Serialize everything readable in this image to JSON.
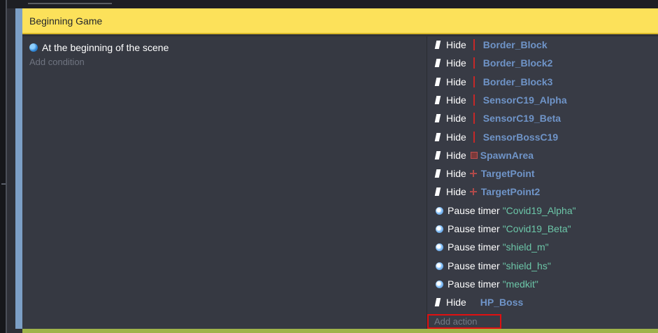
{
  "group": {
    "title": "Beginning Game"
  },
  "event": {
    "condition_label": "At the beginning of the scene",
    "condition_icon": "scene-start-icon",
    "add_condition": "Add condition",
    "add_action": "Add action"
  },
  "actions": [
    {
      "verb": "Hide",
      "icon": "hide-icon",
      "marker": "red-bar",
      "object": "Border_Block"
    },
    {
      "verb": "Hide",
      "icon": "hide-icon",
      "marker": "red-bar",
      "object": "Border_Block2"
    },
    {
      "verb": "Hide",
      "icon": "hide-icon",
      "marker": "red-bar",
      "object": "Border_Block3"
    },
    {
      "verb": "Hide",
      "icon": "hide-icon",
      "marker": "red-bar",
      "object": "SensorC19_Alpha"
    },
    {
      "verb": "Hide",
      "icon": "hide-icon",
      "marker": "red-bar",
      "object": "SensorC19_Beta"
    },
    {
      "verb": "Hide",
      "icon": "hide-icon",
      "marker": "red-bar",
      "object": "SensorBossC19"
    },
    {
      "verb": "Hide",
      "icon": "hide-icon",
      "marker": "red-box",
      "object": "SpawnArea"
    },
    {
      "verb": "Hide",
      "icon": "hide-icon",
      "marker": "red-cross",
      "object": "TargetPoint"
    },
    {
      "verb": "Hide",
      "icon": "hide-icon",
      "marker": "red-cross",
      "object": "TargetPoint2"
    },
    {
      "verb": "Pause timer",
      "icon": "timer-icon",
      "timer": "\"Covid19_Alpha\""
    },
    {
      "verb": "Pause timer",
      "icon": "timer-icon",
      "timer": "\"Covid19_Beta\""
    },
    {
      "verb": "Pause timer",
      "icon": "timer-icon",
      "timer": "\"shield_m\""
    },
    {
      "verb": "Pause timer",
      "icon": "timer-icon",
      "timer": "\"shield_hs\""
    },
    {
      "verb": "Pause timer",
      "icon": "timer-icon",
      "timer": "\"medkit\""
    },
    {
      "verb": "Hide",
      "icon": "hide-icon",
      "marker": "none",
      "object": "HP_Boss"
    }
  ],
  "colors": {
    "group_header_bg": "#fce15a",
    "event_bg": "#383b45",
    "object_name": "#6f94c8",
    "timer_string": "#6cc6a8",
    "highlight_box": "#e01010"
  }
}
